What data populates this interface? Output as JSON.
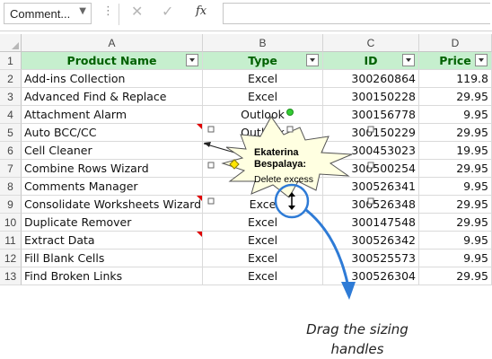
{
  "formula_bar": {
    "name_box": "Comment...",
    "dots": "⋮",
    "cancel_icon": "✕",
    "enter_icon": "✓",
    "fx": "fx",
    "formula": ""
  },
  "columns": [
    "A",
    "B",
    "C",
    "D"
  ],
  "rows": [
    "1",
    "2",
    "3",
    "4",
    "5",
    "6",
    "7",
    "8",
    "9",
    "10",
    "11",
    "12",
    "13"
  ],
  "header": {
    "product": "Product Name",
    "type": "Type",
    "id": "ID",
    "price": "Price"
  },
  "data": [
    {
      "product": "Add-ins Collection",
      "type": "Excel",
      "id": "300260864",
      "price": "119.8"
    },
    {
      "product": "Advanced Find & Replace",
      "type": "Excel",
      "id": "300150228",
      "price": "29.95"
    },
    {
      "product": "Attachment Alarm",
      "type": "Outlook",
      "id": "300156778",
      "price": "9.95"
    },
    {
      "product": "Auto BCC/CC",
      "type": "Outlook",
      "id": "300150229",
      "price": "29.95"
    },
    {
      "product": "Cell Cleaner",
      "type": "",
      "id": "300453023",
      "price": "19.95"
    },
    {
      "product": "Combine Rows Wizard",
      "type": "",
      "id": "300500254",
      "price": "29.95"
    },
    {
      "product": "Comments Manager",
      "type": "",
      "id": "300526341",
      "price": "9.95"
    },
    {
      "product": "Consolidate Worksheets Wizard",
      "type": "Exce",
      "id": "300526348",
      "price": "29.95"
    },
    {
      "product": "Duplicate Remover",
      "type": "Excel",
      "id": "300147548",
      "price": "29.95"
    },
    {
      "product": "Extract Data",
      "type": "Excel",
      "id": "300526342",
      "price": "9.95"
    },
    {
      "product": "Fill Blank Cells",
      "type": "Excel",
      "id": "300525573",
      "price": "9.95"
    },
    {
      "product": "Find Broken Links",
      "type": "Excel",
      "id": "300526304",
      "price": "29.95"
    }
  ],
  "comment": {
    "author": "Ekaterina Bespalaya:",
    "author_line1": "Ekaterina",
    "author_line2": "Bespalaya:",
    "text": "Delete excess"
  },
  "caption": {
    "line1": "Drag the sizing",
    "line2": "handles"
  },
  "colors": {
    "header_fill": "#c6efce",
    "header_text": "#006100",
    "comment_fill": "#ffffe1",
    "annotation_blue": "#2e7bd6",
    "rotate_handle": "#33cc33",
    "comment_indicator": "#e00000"
  }
}
